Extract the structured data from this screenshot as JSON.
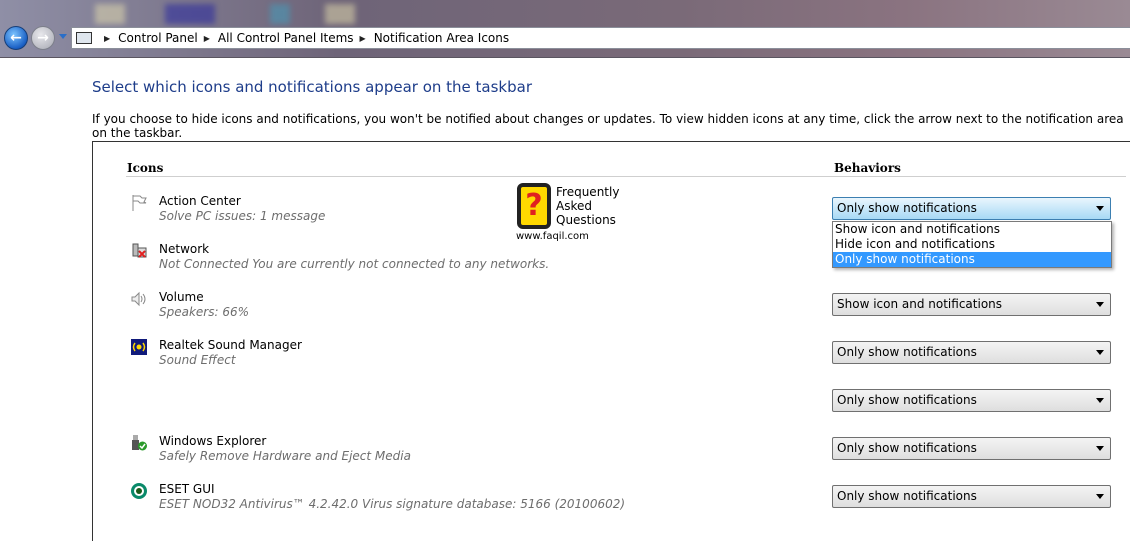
{
  "address_bar": {
    "breadcrumbs": [
      "Control Panel",
      "All Control Panel Items",
      "Notification Area Icons"
    ]
  },
  "page": {
    "title": "Select which icons and notifications appear on the taskbar",
    "description": "If you choose to hide icons and notifications, you won't be notified about changes or updates. To view hidden icons at any time, click the arrow next to the notification area on the taskbar."
  },
  "columns": {
    "icons": "Icons",
    "behaviors": "Behaviors"
  },
  "rows": [
    {
      "name": "Action Center",
      "sub": "Solve PC issues: 1 message",
      "icon": "flag-icon",
      "behavior": "Only show notifications"
    },
    {
      "name": "Network",
      "sub": "Not Connected You are currently not connected to any networks.",
      "icon": "network-disconnected-icon",
      "behavior": ""
    },
    {
      "name": "Volume",
      "sub": "Speakers: 66%",
      "icon": "speaker-icon",
      "behavior": "Show icon and notifications"
    },
    {
      "name": "Realtek Sound Manager",
      "sub": "Sound Effect",
      "icon": "realtek-icon",
      "behavior": "Only show notifications"
    },
    {
      "name": "",
      "sub": "",
      "icon": "",
      "behavior": "Only show notifications"
    },
    {
      "name": "Windows Explorer",
      "sub": "Safely Remove Hardware and Eject Media",
      "icon": "usb-safe-remove-icon",
      "behavior": "Only show notifications"
    },
    {
      "name": "ESET GUI",
      "sub": "ESET NOD32 Antivirus™ 4.2.42.0 Virus signature database: 5166 (20100602)",
      "icon": "eset-icon",
      "behavior": "Only show notifications"
    }
  ],
  "dropdown_options": [
    "Show icon and notifications",
    "Hide icon and notifications",
    "Only show notifications"
  ],
  "dropdown_highlighted": "Only show notifications",
  "watermark": {
    "text": "Frequently Asked Questions",
    "url": "www.faqil.com"
  },
  "colors": {
    "title": "#1e3d8a",
    "highlight": "#3399ff"
  }
}
